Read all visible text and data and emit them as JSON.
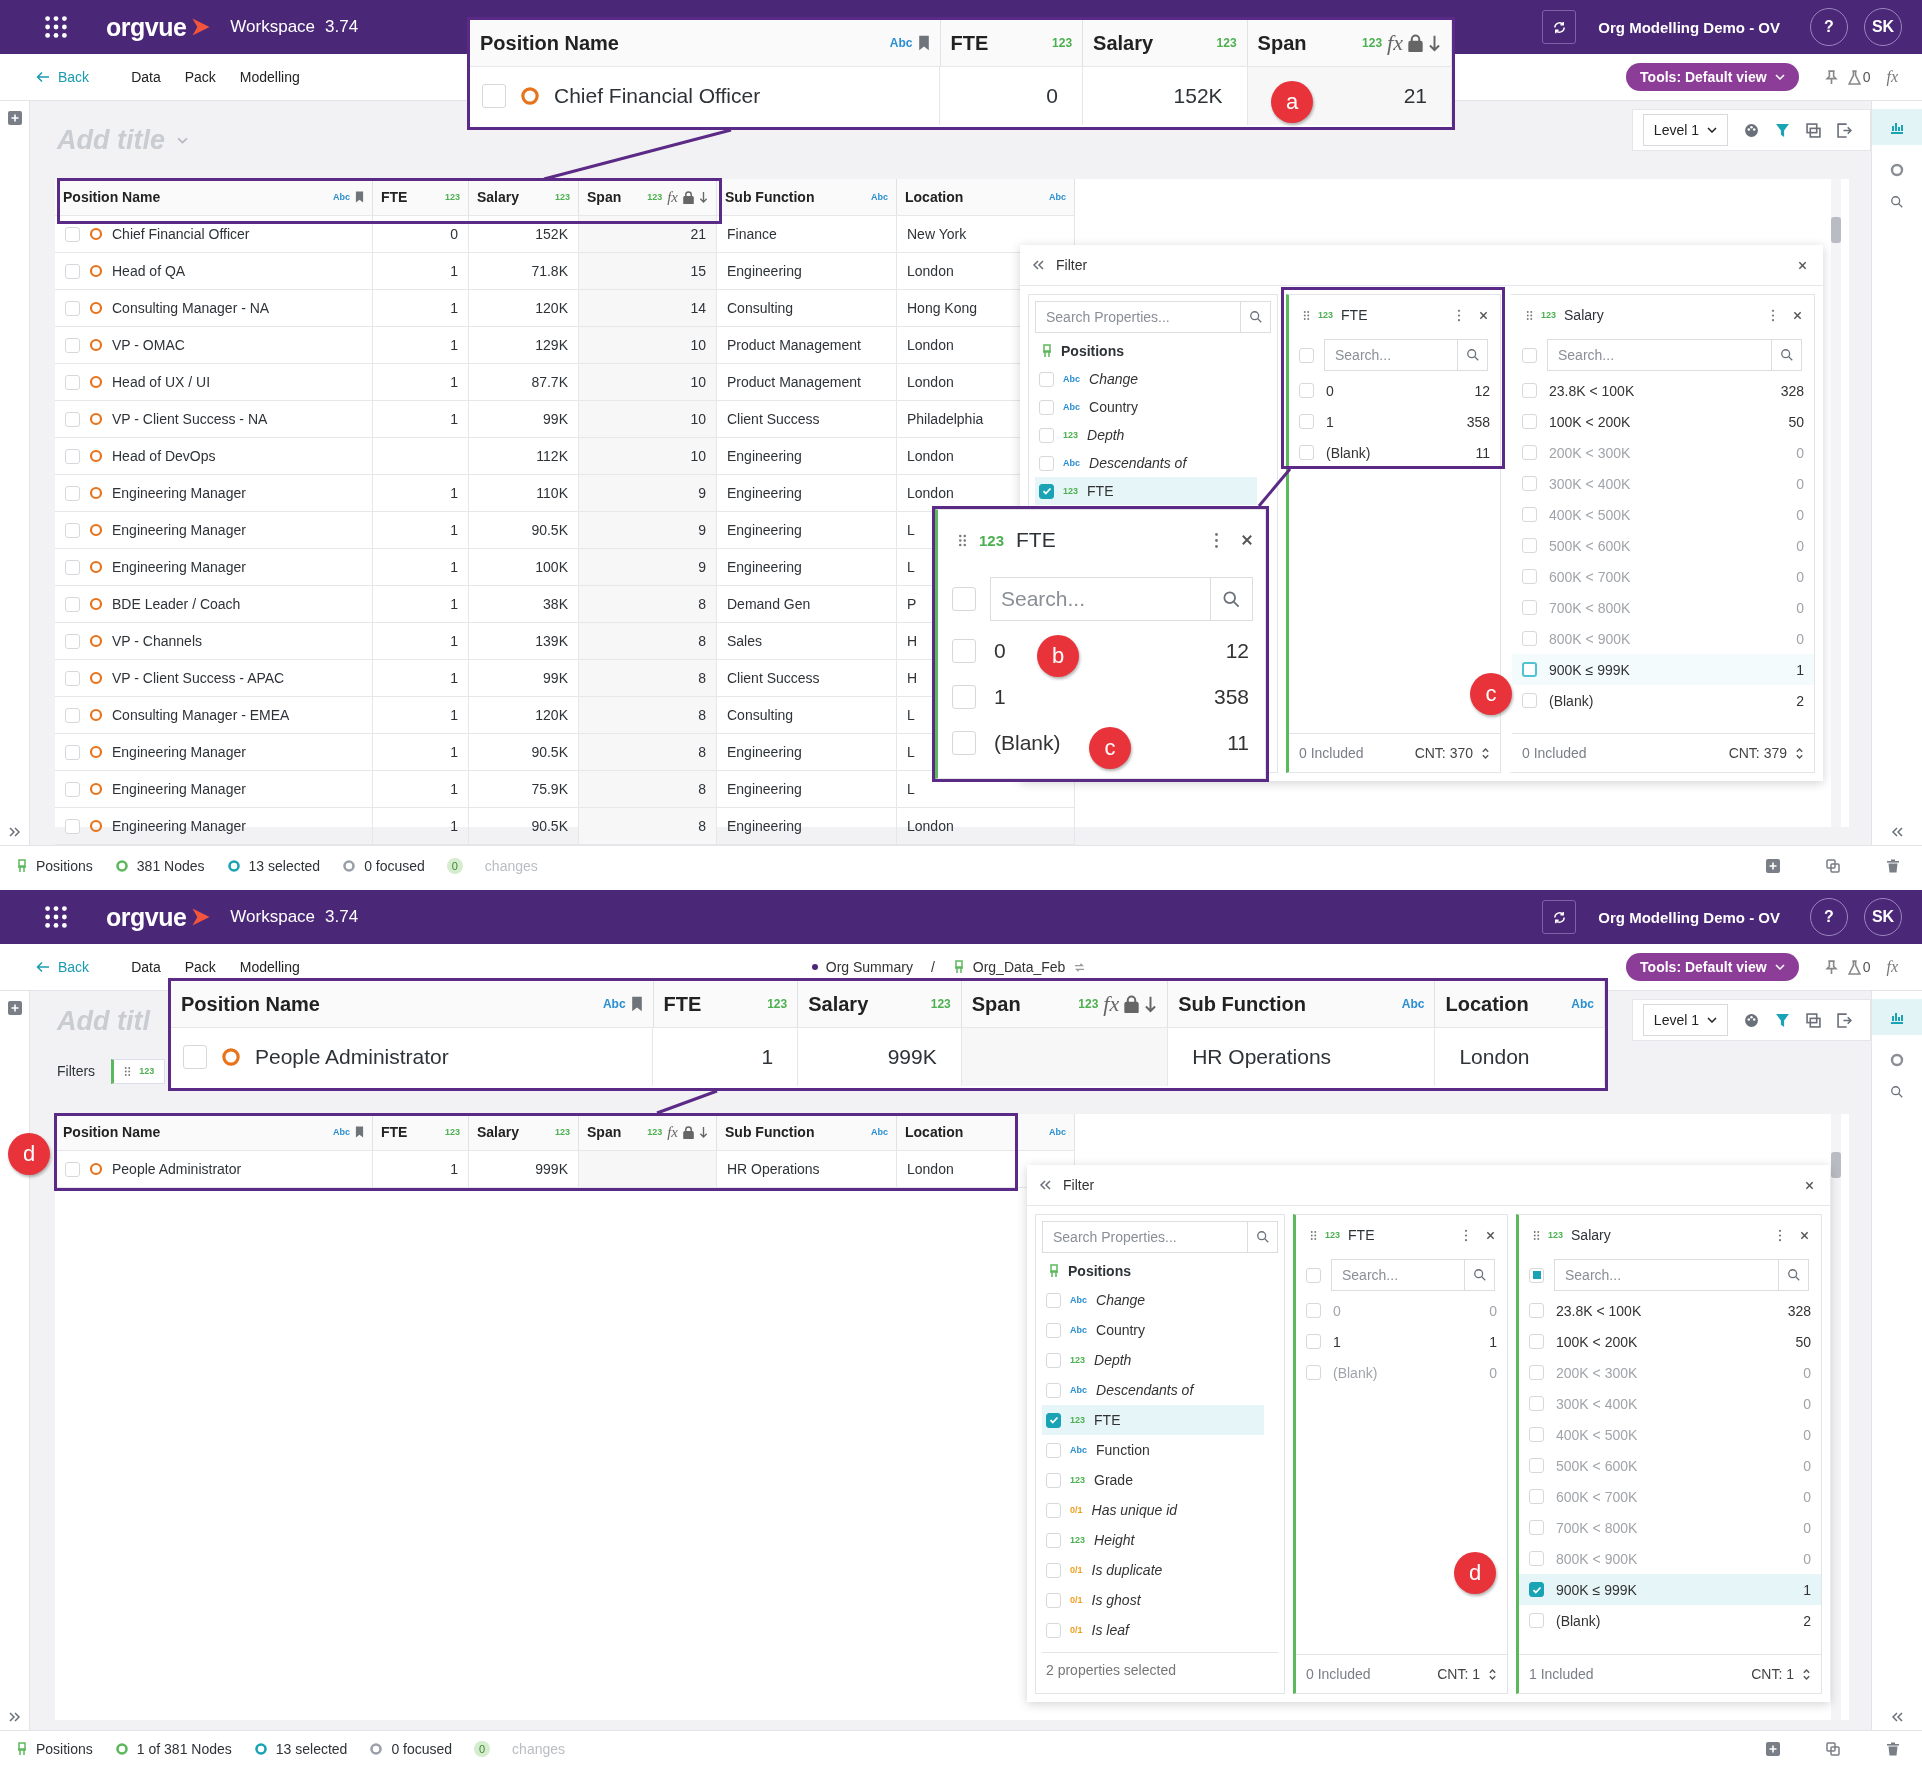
{
  "screens": [
    {
      "header": {
        "app_name": "orgvue",
        "workspace": "Workspace",
        "version": "3.74",
        "project": "Org Modelling Demo - OV",
        "help": "?",
        "avatar": "SK"
      },
      "nav": {
        "back": "Back",
        "tabs": [
          "Data",
          "Pack",
          "Modelling"
        ],
        "tools": "Tools: Default view",
        "flask_count": "0",
        "formula": "fx"
      },
      "title_placeholder": "Add title",
      "title_dropdown": true,
      "view_level": "Level 1",
      "table": {
        "columns": [
          {
            "name": "Position Name",
            "type": "Abc",
            "bookmark": true
          },
          {
            "name": "FTE",
            "type": "123"
          },
          {
            "name": "Salary",
            "type": "123"
          },
          {
            "name": "Span",
            "type": "123",
            "formula": "fx",
            "locked": true,
            "sorted": true
          },
          {
            "name": "Sub Function",
            "type": "Abc"
          },
          {
            "name": "Location",
            "type": "Abc"
          }
        ],
        "rows": [
          {
            "checked": false,
            "cells": [
              "Chief Financial Officer",
              "0",
              "152K",
              "21",
              "Finance",
              "New York"
            ]
          },
          {
            "checked": false,
            "cells": [
              "Head of QA",
              "1",
              "71.8K",
              "15",
              "Engineering",
              "London"
            ]
          },
          {
            "checked": false,
            "cells": [
              "Consulting Manager - NA",
              "1",
              "120K",
              "14",
              "Consulting",
              "Hong Kong"
            ]
          },
          {
            "checked": false,
            "cells": [
              "VP - OMAC",
              "1",
              "129K",
              "10",
              "Product Management",
              "London"
            ]
          },
          {
            "checked": false,
            "cells": [
              "Head of UX / UI",
              "1",
              "87.7K",
              "10",
              "Product Management",
              "London"
            ]
          },
          {
            "checked": false,
            "cells": [
              "VP - Client Success - NA",
              "1",
              "99K",
              "10",
              "Client Success",
              "Philadelphia"
            ]
          },
          {
            "checked": false,
            "cells": [
              "Head of DevOps",
              null,
              "112K",
              "10",
              "Engineering",
              "London"
            ]
          },
          {
            "checked": false,
            "cells": [
              "Engineering Manager",
              "1",
              "110K",
              "9",
              "Engineering",
              "London"
            ]
          },
          {
            "checked": false,
            "cells": [
              "Engineering Manager",
              "1",
              "90.5K",
              "9",
              "Engineering",
              "L"
            ]
          },
          {
            "checked": false,
            "cells": [
              "Engineering Manager",
              "1",
              "100K",
              "9",
              "Engineering",
              "L"
            ]
          },
          {
            "checked": false,
            "cells": [
              "BDE Leader / Coach",
              "1",
              "38K",
              "8",
              "Demand Gen",
              "P"
            ]
          },
          {
            "checked": false,
            "cells": [
              "VP - Channels",
              "1",
              "139K",
              "8",
              "Sales",
              "H"
            ]
          },
          {
            "checked": false,
            "cells": [
              "VP - Client Success - APAC",
              "1",
              "99K",
              "8",
              "Client Success",
              "H"
            ]
          },
          {
            "checked": false,
            "cells": [
              "Consulting Manager - EMEA",
              "1",
              "120K",
              "8",
              "Consulting",
              "L"
            ]
          },
          {
            "checked": false,
            "cells": [
              "Engineering Manager",
              "1",
              "90.5K",
              "8",
              "Engineering",
              "L"
            ]
          },
          {
            "checked": false,
            "cells": [
              "Engineering Manager",
              "1",
              "75.9K",
              "8",
              "Engineering",
              "L"
            ]
          },
          {
            "checked": false,
            "cells": [
              "Engineering Manager",
              "1",
              "90.5K",
              "8",
              "Engineering",
              "London"
            ]
          }
        ]
      },
      "filter_panel": {
        "title": "Filter",
        "search_placeholder": "Search Properties...",
        "entity": "Positions",
        "properties": [
          {
            "type": "Abc",
            "name": "Change",
            "calculated": true,
            "checked": false
          },
          {
            "type": "Abc",
            "name": "Country",
            "calculated": false,
            "checked": false
          },
          {
            "type": "123",
            "name": "Depth",
            "calculated": true,
            "checked": false
          },
          {
            "type": "Abc",
            "name": "Descendants of",
            "calculated": true,
            "checked": false
          },
          {
            "type": "123",
            "name": "FTE",
            "calculated": false,
            "checked": true
          }
        ],
        "cards": [
          {
            "type": "123",
            "name": "FTE",
            "active": true,
            "partial": false,
            "search_placeholder": "Search...",
            "included": "0 Included",
            "count": "CNT: 370",
            "items": [
              {
                "label": "0",
                "count": "12",
                "checked": false,
                "muted": false,
                "focused": false
              },
              {
                "label": "1",
                "count": "358",
                "checked": false,
                "muted": false,
                "focused": false
              },
              {
                "label": "(Blank)",
                "count": "11",
                "checked": false,
                "muted": false,
                "focused": false
              }
            ]
          },
          {
            "type": "123",
            "name": "Salary",
            "active": false,
            "partial": false,
            "search_placeholder": "Search...",
            "included": "0 Included",
            "count": "CNT: 379",
            "items": [
              {
                "label": "23.8K < 100K",
                "count": "328",
                "checked": false,
                "muted": false,
                "focused": false
              },
              {
                "label": "100K < 200K",
                "count": "50",
                "checked": false,
                "muted": false,
                "focused": false
              },
              {
                "label": "200K < 300K",
                "count": "0",
                "checked": false,
                "muted": true,
                "focused": false
              },
              {
                "label": "300K < 400K",
                "count": "0",
                "checked": false,
                "muted": true,
                "focused": false
              },
              {
                "label": "400K < 500K",
                "count": "0",
                "checked": false,
                "muted": true,
                "focused": false
              },
              {
                "label": "500K < 600K",
                "count": "0",
                "checked": false,
                "muted": true,
                "focused": false
              },
              {
                "label": "600K < 700K",
                "count": "0",
                "checked": false,
                "muted": true,
                "focused": false
              },
              {
                "label": "700K < 800K",
                "count": "0",
                "checked": false,
                "muted": true,
                "focused": false
              },
              {
                "label": "800K < 900K",
                "count": "0",
                "checked": false,
                "muted": true,
                "focused": false
              },
              {
                "label": "900K ≤ 999K",
                "count": "1",
                "checked": false,
                "muted": false,
                "focused": true
              },
              {
                "label": "(Blank)",
                "count": "2",
                "checked": false,
                "muted": false,
                "focused": false
              }
            ]
          }
        ]
      },
      "status_bar": {
        "entity": "Positions",
        "nodes": "381 Nodes",
        "selected": "13 selected",
        "focused": "0 focused",
        "changes_count": "0",
        "changes": "changes"
      },
      "callouts": [
        {
          "kind": "table",
          "columns": [
            {
              "name": "Position Name",
              "type": "Abc",
              "bookmark": true
            },
            {
              "name": "FTE",
              "type": "123"
            },
            {
              "name": "Salary",
              "type": "123"
            },
            {
              "name": "Span",
              "type": "123",
              "formula": "fx",
              "locked": true,
              "sorted": true
            }
          ],
          "checked": false,
          "cells": [
            "Chief Financial Officer",
            "0",
            "152K",
            "21"
          ]
        },
        {
          "kind": "filter_card",
          "type": "123",
          "name": "FTE",
          "active": true,
          "partial": false,
          "search_placeholder": "Search...",
          "items": [
            {
              "label": "0",
              "count": "12",
              "checked": false
            },
            {
              "label": "1",
              "count": "358",
              "checked": false
            },
            {
              "label": "(Blank)",
              "count": "11",
              "checked": false
            }
          ]
        }
      ],
      "markers": [
        "a",
        "b",
        "c",
        "c"
      ]
    },
    {
      "header": {
        "app_name": "orgvue",
        "workspace": "Workspace",
        "version": "3.74",
        "project": "Org Modelling Demo - OV",
        "help": "?",
        "avatar": "SK"
      },
      "nav": {
        "back": "Back",
        "tabs": [
          "Data",
          "Pack",
          "Modelling"
        ],
        "breadcrumb": {
          "items": [
            "Org Summary",
            "Org_Data_Feb"
          ],
          "separator": "/"
        },
        "tools": "Tools: Default view",
        "flask_count": "0",
        "formula": "fx"
      },
      "title_placeholder": "Add titl",
      "title_dropdown": false,
      "view_level": "Level 1",
      "filters": {
        "label": "Filters",
        "chips": [
          {
            "type": "123"
          }
        ]
      },
      "table": {
        "columns": [
          {
            "name": "Position Name",
            "type": "Abc",
            "bookmark": true
          },
          {
            "name": "FTE",
            "type": "123"
          },
          {
            "name": "Salary",
            "type": "123"
          },
          {
            "name": "Span",
            "type": "123",
            "formula": "fx",
            "locked": true,
            "sorted": true
          },
          {
            "name": "Sub Function",
            "type": "Abc"
          },
          {
            "name": "Location",
            "type": "Abc"
          }
        ],
        "rows": [
          {
            "checked": false,
            "cells": [
              "People Administrator",
              "1",
              "999K",
              null,
              "HR Operations",
              "London"
            ]
          }
        ]
      },
      "filter_panel": {
        "title": "Filter",
        "search_placeholder": "Search Properties...",
        "entity": "Positions",
        "properties": [
          {
            "type": "Abc",
            "name": "Change",
            "calculated": true,
            "checked": false
          },
          {
            "type": "Abc",
            "name": "Country",
            "calculated": false,
            "checked": false
          },
          {
            "type": "123",
            "name": "Depth",
            "calculated": true,
            "checked": false
          },
          {
            "type": "Abc",
            "name": "Descendants of",
            "calculated": true,
            "checked": false
          },
          {
            "type": "123",
            "name": "FTE",
            "calculated": false,
            "checked": true
          },
          {
            "type": "Abc",
            "name": "Function",
            "calculated": false,
            "checked": false
          },
          {
            "type": "123",
            "name": "Grade",
            "calculated": false,
            "checked": false
          },
          {
            "type": "0/1",
            "name": "Has unique id",
            "calculated": true,
            "checked": false
          },
          {
            "type": "123",
            "name": "Height",
            "calculated": true,
            "checked": false
          },
          {
            "type": "0/1",
            "name": "Is duplicate",
            "calculated": true,
            "checked": false
          },
          {
            "type": "0/1",
            "name": "Is ghost",
            "calculated": true,
            "checked": false
          },
          {
            "type": "0/1",
            "name": "Is leaf",
            "calculated": true,
            "checked": false
          }
        ],
        "footer": "2 properties selected",
        "cards": [
          {
            "type": "123",
            "name": "FTE",
            "active": true,
            "partial": false,
            "search_placeholder": "Search...",
            "included": "0 Included",
            "count": "CNT: 1",
            "items": [
              {
                "label": "0",
                "count": "0",
                "checked": false,
                "muted": true,
                "focused": false
              },
              {
                "label": "1",
                "count": "1",
                "checked": false,
                "muted": false,
                "focused": false
              },
              {
                "label": "(Blank)",
                "count": "0",
                "checked": false,
                "muted": true,
                "focused": false
              }
            ]
          },
          {
            "type": "123",
            "name": "Salary",
            "active": true,
            "partial": true,
            "search_placeholder": "Search...",
            "included": "1 Included",
            "count": "CNT: 1",
            "items": [
              {
                "label": "23.8K < 100K",
                "count": "328",
                "checked": false,
                "muted": false,
                "focused": false
              },
              {
                "label": "100K < 200K",
                "count": "50",
                "checked": false,
                "muted": false,
                "focused": false
              },
              {
                "label": "200K < 300K",
                "count": "0",
                "checked": false,
                "muted": true,
                "focused": false
              },
              {
                "label": "300K < 400K",
                "count": "0",
                "checked": false,
                "muted": true,
                "focused": false
              },
              {
                "label": "400K < 500K",
                "count": "0",
                "checked": false,
                "muted": true,
                "focused": false
              },
              {
                "label": "500K < 600K",
                "count": "0",
                "checked": false,
                "muted": true,
                "focused": false
              },
              {
                "label": "600K < 700K",
                "count": "0",
                "checked": false,
                "muted": true,
                "focused": false
              },
              {
                "label": "700K < 800K",
                "count": "0",
                "checked": false,
                "muted": true,
                "focused": false
              },
              {
                "label": "800K < 900K",
                "count": "0",
                "checked": false,
                "muted": true,
                "focused": false
              },
              {
                "label": "900K ≤ 999K",
                "count": "1",
                "checked": true,
                "muted": false,
                "focused": false
              },
              {
                "label": "(Blank)",
                "count": "2",
                "checked": false,
                "muted": false,
                "focused": false
              }
            ]
          }
        ]
      },
      "status_bar": {
        "entity": "Positions",
        "nodes": "1 of 381 Nodes",
        "selected": "13 selected",
        "focused": "0 focused",
        "changes_count": "0",
        "changes": "changes"
      },
      "callouts": [
        {
          "kind": "table",
          "columns": [
            {
              "name": "Position Name",
              "type": "Abc",
              "bookmark": true
            },
            {
              "name": "FTE",
              "type": "123"
            },
            {
              "name": "Salary",
              "type": "123"
            },
            {
              "name": "Span",
              "type": "123",
              "formula": "fx",
              "locked": true,
              "sorted": true
            },
            {
              "name": "Sub Function",
              "type": "Abc"
            },
            {
              "name": "Location",
              "type": "Abc"
            }
          ],
          "checked": false,
          "cells": [
            "People Administrator",
            "1",
            "999K",
            null,
            "HR Operations",
            "London"
          ]
        }
      ],
      "markers": [
        "d",
        "d"
      ]
    }
  ]
}
